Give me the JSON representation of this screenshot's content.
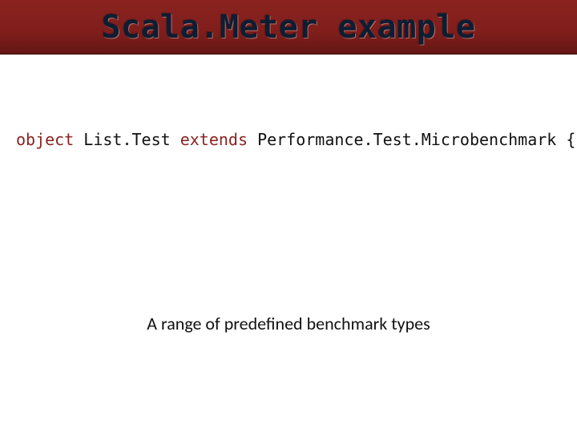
{
  "title": "Scala.Meter example",
  "code": {
    "kw_object": "object",
    "sp1": " ",
    "id1": "List.Test ",
    "kw_extends": "extends",
    "sp2": " ",
    "id2": "Performance.Test.Microbenchmark {"
  },
  "caption": "A range of predefined benchmark types"
}
